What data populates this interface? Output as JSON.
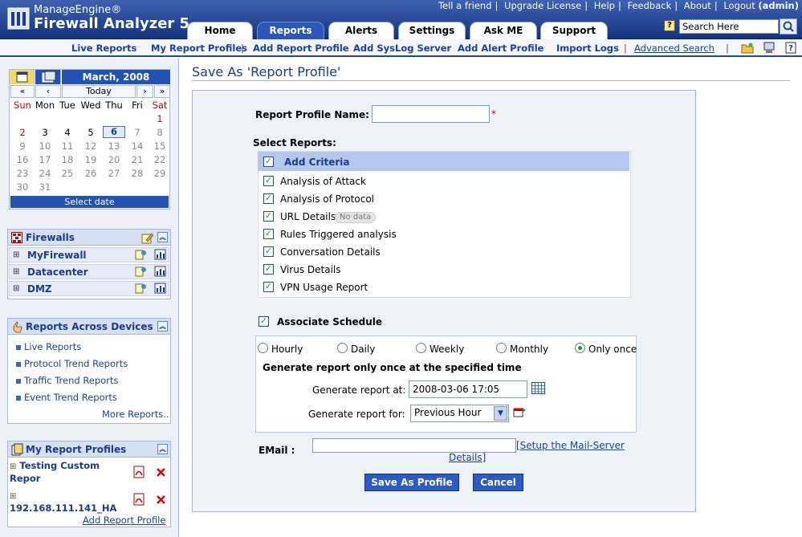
{
  "brand": {
    "top": "ManageEngine®",
    "name": "Firewall Analyzer 5"
  },
  "toplinks": [
    "Tell a friend",
    "Upgrade License",
    "Help",
    "Feedback",
    "About",
    "Logout"
  ],
  "user": "(admin)",
  "tabs": [
    "Home",
    "Reports",
    "Alerts",
    "Settings",
    "Ask ME",
    "Support"
  ],
  "active_tab": "Reports",
  "search": {
    "value": "Search Here"
  },
  "subnav": [
    "Live Reports",
    "My Report Profiles",
    "Add Report Profile",
    "Add SysLog Server",
    "Add Alert Profile",
    "Import Logs",
    "Advanced Search"
  ],
  "subnav_sep": "|",
  "calendar": {
    "month": "March, 2008",
    "nav": [
      "«",
      "‹",
      "Today",
      "›",
      "»"
    ],
    "weekdays": [
      "Sun",
      "Mon",
      "Tue",
      "Wed",
      "Thu",
      "Fri",
      "Sat"
    ],
    "weeks": [
      [
        "",
        "",
        "",
        "",
        "",
        "",
        "1"
      ],
      [
        "2",
        "3",
        "4",
        "5",
        "6",
        "7",
        "8"
      ],
      [
        "9",
        "10",
        "11",
        "12",
        "13",
        "14",
        "15"
      ],
      [
        "16",
        "17",
        "18",
        "19",
        "20",
        "21",
        "22"
      ],
      [
        "23",
        "24",
        "25",
        "26",
        "27",
        "28",
        "29"
      ],
      [
        "30",
        "31",
        "",
        "",
        "",
        "",
        ""
      ]
    ],
    "today": "6",
    "footer": "Select date"
  },
  "firewalls": {
    "title": "Firewalls",
    "items": [
      "MyFirewall",
      "Datacenter",
      "DMZ"
    ]
  },
  "reports_across": {
    "title": "Reports Across Devices",
    "links": [
      "Live Reports",
      "Protocol Trend Reports",
      "Traffic Trend Reports",
      "Event Trend Reports"
    ],
    "more": "More Reports.."
  },
  "my_profiles": {
    "title": "My Report Profiles",
    "items": [
      {
        "line1": "Testing Custom",
        "line2": "Repor"
      },
      {
        "line1": "",
        "line2": "192.168.111.141_HA"
      }
    ],
    "add": "Add Report Profile"
  },
  "main": {
    "title": "Save As 'Report Profile'",
    "profile_name_label": "Report Profile Name:",
    "profile_name_value": "",
    "required_mark": "*",
    "select_reports_label": "Select Reports:",
    "criteria_header": "Add Criteria",
    "reports": [
      {
        "label": "Analysis of Attack",
        "checked": true
      },
      {
        "label": "Analysis of Protocol",
        "checked": true
      },
      {
        "label": "URL Details",
        "checked": true,
        "badge": "No data"
      },
      {
        "label": "Rules Triggered analysis",
        "checked": true
      },
      {
        "label": "Conversation Details",
        "checked": true
      },
      {
        "label": "Virus Details",
        "checked": true
      },
      {
        "label": "VPN Usage Report",
        "checked": true
      }
    ],
    "associate_schedule": "Associate Schedule",
    "schedule_options": [
      "Hourly",
      "Daily",
      "Weekly",
      "Monthly",
      "Only once"
    ],
    "schedule_selected": "Only once",
    "schedule_desc": "Generate report only once at the specified time",
    "generate_at_label": "Generate report at:",
    "generate_at_value": "2008-03-06 17:05",
    "generate_for_label": "Generate report for:",
    "generate_for_value": "Previous Hour",
    "email_label": "EMail  :",
    "email_value": "",
    "mail_setup_line1": "[Setup the Mail-Server",
    "mail_setup_line2": "Details]",
    "save_button": "Save As Profile",
    "cancel_button": "Cancel"
  }
}
